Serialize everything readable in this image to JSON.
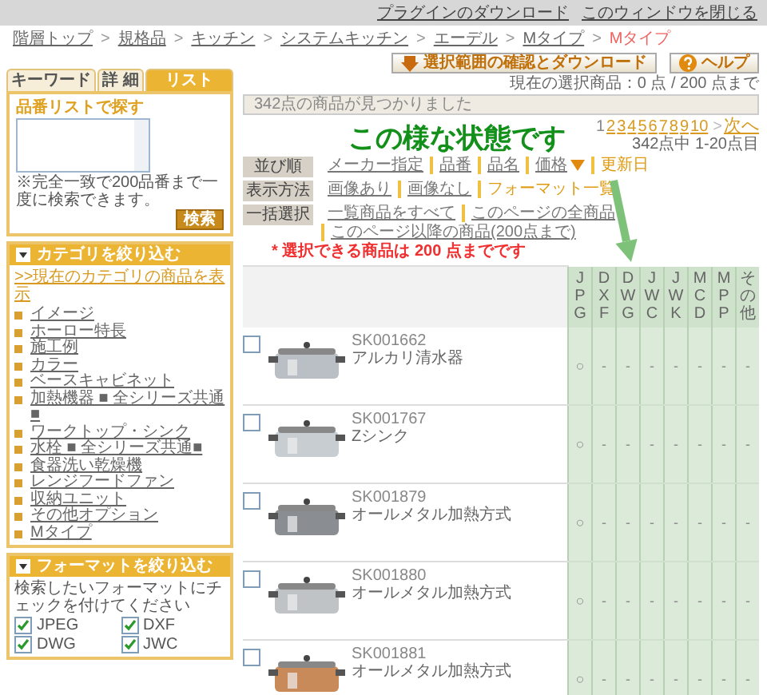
{
  "top_links": [
    "プラグインのダウンロード",
    "このウィンドウを閉じる"
  ],
  "breadcrumb": {
    "separator": ">",
    "items": [
      {
        "label": "階層トップ",
        "current": false
      },
      {
        "label": "規格品",
        "current": false
      },
      {
        "label": "キッチン",
        "current": false
      },
      {
        "label": "システムキッチン",
        "current": false
      },
      {
        "label": "エーデル",
        "current": false
      },
      {
        "label": "Mタイプ",
        "current": false
      },
      {
        "label": "Mタイプ",
        "current": true
      }
    ]
  },
  "sidebar": {
    "tabs": [
      {
        "label": "キーワード",
        "selected": false
      },
      {
        "label": "詳 細",
        "selected": false
      },
      {
        "label": "リスト",
        "selected": true
      }
    ],
    "list_search": {
      "heading": "品番リストで探す",
      "hint": "※完全一致で200品番まで一度に検索できます。",
      "button": "検索"
    },
    "category": {
      "title": "カテゴリを絞り込む",
      "show_all_link": ">>現在のカテゴリの商品を表示",
      "items": [
        "イメージ",
        "ホーロー特長",
        "施工例",
        "カラー",
        "ベースキャビネット",
        "加熱機器 ■ 全シリーズ共通■",
        "ワークトップ・シンク",
        "水栓 ■ 全シリーズ共通■",
        "食器洗い乾燥機",
        "レンジフードファン",
        "収納ユニット",
        "その他オプション",
        "Mタイプ"
      ]
    },
    "format": {
      "title": "フォーマットを絞り込む",
      "hint": "検索したいフォーマットにチェックを付けてください",
      "options": [
        {
          "label": "JPEG",
          "checked": true
        },
        {
          "label": "DXF",
          "checked": true
        },
        {
          "label": "DWG",
          "checked": true
        },
        {
          "label": "JWC",
          "checked": true
        }
      ]
    }
  },
  "buttons": [
    {
      "kind": "download",
      "label": "選択範囲の確認とダウンロード"
    },
    {
      "kind": "help",
      "label": "ヘルプ"
    }
  ],
  "selection_status": "現在の選択商品：0 点 / 200 点まで",
  "result_message": "342点の商品が見つかりました",
  "annotation": "この様な状態です",
  "pagination": {
    "pages": [
      {
        "label": "1",
        "selected": true
      },
      {
        "label": "2",
        "selected": false
      },
      {
        "label": "3",
        "selected": false
      },
      {
        "label": "4",
        "selected": false
      },
      {
        "label": "5",
        "selected": false
      },
      {
        "label": "6",
        "selected": false
      },
      {
        "label": "7",
        "selected": false
      },
      {
        "label": "8",
        "selected": false
      },
      {
        "label": "9",
        "selected": false
      },
      {
        "label": "10",
        "selected": false
      }
    ],
    "next_arrow": ">",
    "next": "次へ",
    "range": "342点中 1-20点目"
  },
  "option_rows": [
    {
      "label": "並び順",
      "options": [
        {
          "label": "メーカー指定",
          "selected": false,
          "descending": false
        },
        {
          "label": "品番",
          "selected": false,
          "descending": false
        },
        {
          "label": "品名",
          "selected": false,
          "descending": false
        },
        {
          "label": "価格",
          "selected": false,
          "descending": true
        },
        {
          "label": "更新日",
          "selected": true,
          "descending": false
        }
      ]
    },
    {
      "label": "表示方法",
      "options": [
        {
          "label": "画像あり",
          "selected": false,
          "descending": false
        },
        {
          "label": "画像なし",
          "selected": false,
          "descending": false
        },
        {
          "label": "フォーマット一覧",
          "selected": true,
          "descending": false
        }
      ]
    },
    {
      "label": "一括選択",
      "options": [
        {
          "label": "一覧商品をすべて",
          "selected": false,
          "descending": false
        },
        {
          "label": "このページの全商品",
          "selected": false,
          "descending": false
        },
        {
          "label": "このページ以降の商品(200点まで)",
          "selected": false,
          "descending": false
        }
      ]
    }
  ],
  "note": "* 選択できる商品は 200 点までです",
  "table": {
    "format_columns": [
      "JPG",
      "DXF",
      "DWG",
      "JWC",
      "JWK",
      "MCD",
      "MPP",
      "その他"
    ],
    "rows": [
      {
        "code": "SK001662",
        "name": "アルカリ清水器",
        "checked": false,
        "formats": [
          "○",
          "-",
          "-",
          "-",
          "-",
          "-",
          "-",
          "-"
        ]
      },
      {
        "code": "SK001767",
        "name": "Zシンク",
        "checked": false,
        "formats": [
          "○",
          "-",
          "-",
          "-",
          "-",
          "-",
          "-",
          "-"
        ]
      },
      {
        "code": "SK001879",
        "name": "オールメタル加熱方式",
        "checked": false,
        "formats": [
          "○",
          "-",
          "-",
          "-",
          "-",
          "-",
          "-",
          "-"
        ]
      },
      {
        "code": "SK001880",
        "name": "オールメタル加熱方式",
        "checked": false,
        "formats": [
          "○",
          "-",
          "-",
          "-",
          "-",
          "-",
          "-",
          "-"
        ]
      },
      {
        "code": "SK001881",
        "name": "オールメタル加熱方式",
        "checked": false,
        "formats": [
          "○",
          "-",
          "-",
          "-",
          "-",
          "-",
          "-",
          "-"
        ]
      }
    ]
  }
}
